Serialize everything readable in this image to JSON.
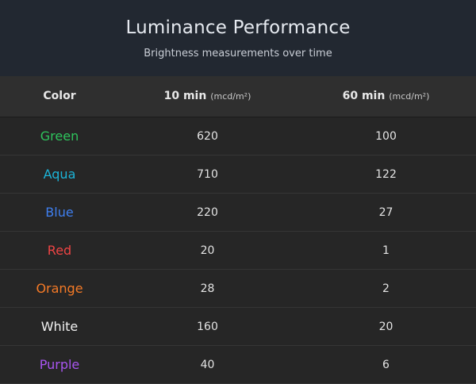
{
  "header": {
    "title": "Luminance Performance",
    "subtitle": "Brightness measurements over time"
  },
  "columns": {
    "color": "Color",
    "t10": {
      "label": "10 min",
      "unit": "(mcd/m²)"
    },
    "t60": {
      "label": "60 min",
      "unit": "(mcd/m²)"
    }
  },
  "colors": {
    "header_bg": "#222831",
    "table_bg": "#262626",
    "header_row_bg": "#2f2f2f"
  },
  "chart_data": {
    "type": "table",
    "title": "Luminance Performance",
    "subtitle": "Brightness measurements over time",
    "columns": [
      "Color",
      "10 min (mcd/m²)",
      "60 min (mcd/m²)"
    ],
    "rows": [
      {
        "name": "Green",
        "color": "#2ec45c",
        "t10": "620",
        "t60": "100"
      },
      {
        "name": "Aqua",
        "color": "#1cb4d8",
        "t10": "710",
        "t60": "122"
      },
      {
        "name": "Blue",
        "color": "#3f7ff0",
        "t10": "220",
        "t60": "27"
      },
      {
        "name": "Red",
        "color": "#ee4444",
        "t10": "20",
        "t60": "1"
      },
      {
        "name": "Orange",
        "color": "#f57a26",
        "t10": "28",
        "t60": "2"
      },
      {
        "name": "White",
        "color": "#f2f2f2",
        "t10": "160",
        "t60": "20"
      },
      {
        "name": "Purple",
        "color": "#a855f0",
        "t10": "40",
        "t60": "6"
      }
    ]
  }
}
